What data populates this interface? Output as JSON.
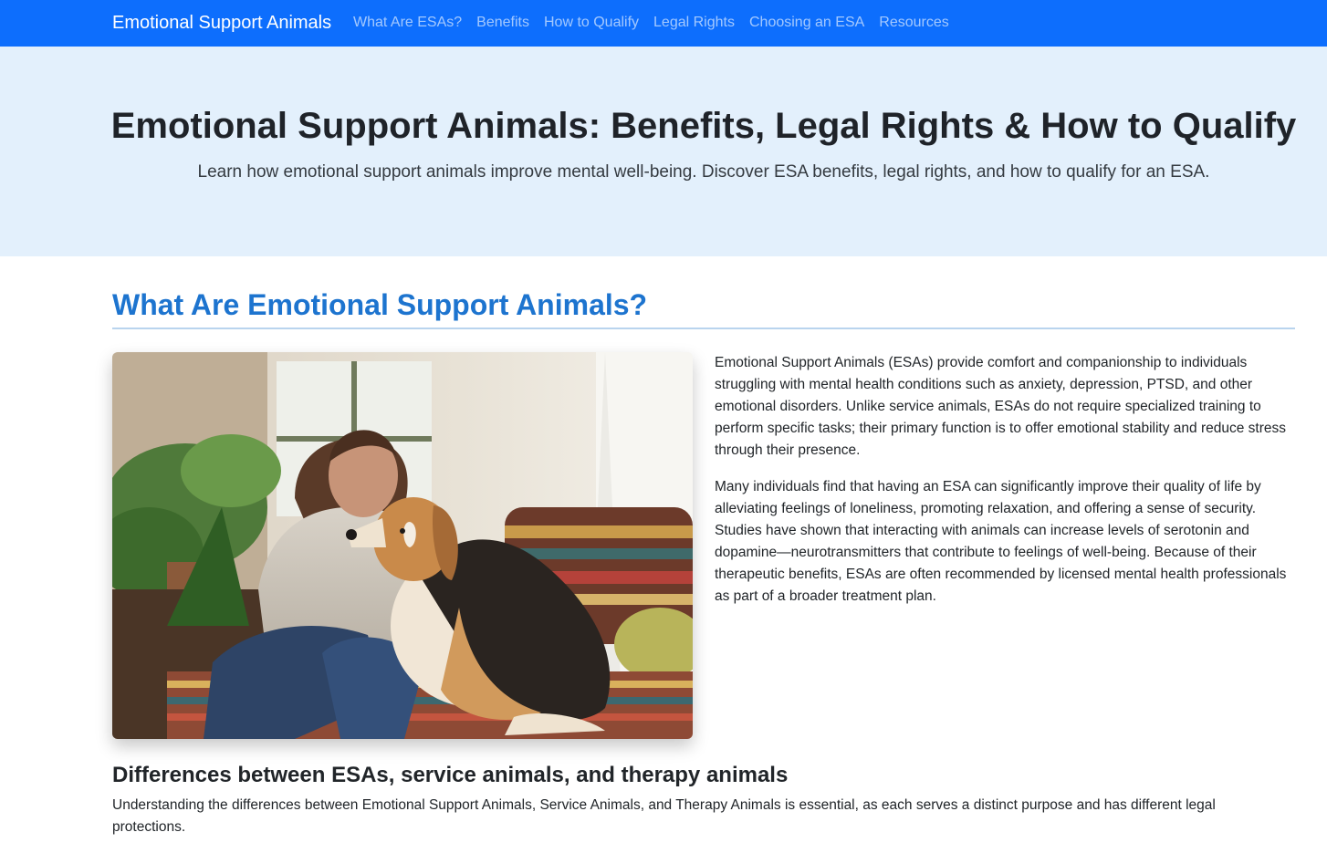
{
  "nav": {
    "brand": "Emotional Support Animals",
    "links": [
      "What Are ESAs?",
      "Benefits",
      "How to Qualify",
      "Legal Rights",
      "Choosing an ESA",
      "Resources"
    ]
  },
  "hero": {
    "title": "Emotional Support Animals: Benefits, Legal Rights & How to Qualify",
    "subtitle": "Learn how emotional support animals improve mental well-being. Discover ESA benefits, legal rights, and how to qualify for an ESA."
  },
  "section": {
    "title": "What Are Emotional Support Animals?",
    "paragraphs": [
      "Emotional Support Animals (ESAs) provide comfort and companionship to individuals struggling with mental health conditions such as anxiety, depression, PTSD, and other emotional disorders. Unlike service animals, ESAs do not require specialized training to perform specific tasks; their primary function is to offer emotional stability and reduce stress through their presence.",
      "Many individuals find that having an ESA can significantly improve their quality of life by alleviating feelings of loneliness, promoting relaxation, and offering a sense of security. Studies have shown that interacting with animals can increase levels of serotonin and dopamine—neurotransmitters that contribute to feelings of well-being. Because of their therapeutic benefits, ESAs are often recommended by licensed mental health professionals as part of a broader treatment plan."
    ],
    "subheading": "Differences between ESAs, service animals, and therapy animals",
    "subtext": "Understanding the differences between Emotional Support Animals, Service Animals, and Therapy Animals is essential, as each serves a distinct purpose and has different legal protections."
  },
  "colors": {
    "navbar": "#0d6efd",
    "hero_background": "#e3f0fc",
    "section_title": "#1d74cf"
  }
}
